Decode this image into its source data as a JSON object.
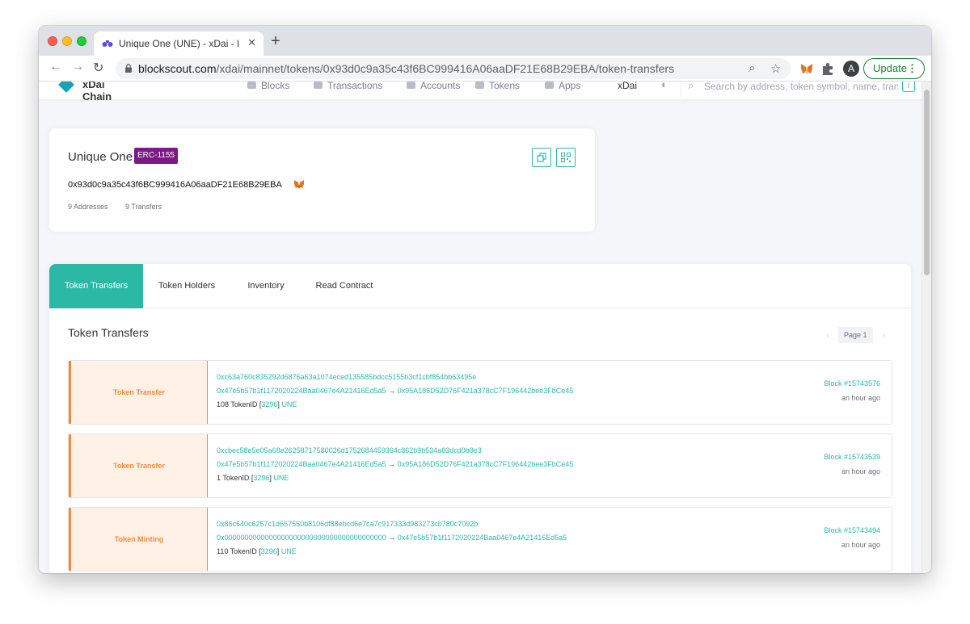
{
  "browser": {
    "tab_title": "Unique One (UNE) - xDai - Blo",
    "tab_close": "✕",
    "new_tab": "+",
    "url_host": "blockscout.com",
    "url_path": "/xdai/mainnet/tokens/0x93d0c9a35c43f6BC999416A06aaDF21E68B29EBA/token-transfers",
    "avatar_letter": "A",
    "update_label": "Update",
    "update_menu": "⋮"
  },
  "site_nav": {
    "logo_text": "xDai Chain",
    "items": [
      "Blocks",
      "Transactions",
      "Accounts",
      "Tokens",
      "Apps",
      "xDai"
    ],
    "search_placeholder": "Search by address, token symbol, name, transaction hash, or block number",
    "search_key": "/"
  },
  "token": {
    "name": "Unique One",
    "standard": "ERC-1155",
    "address": "0x93d0c9a35c43f6BC999416A06aaDF21E68B29EBA",
    "addresses_count": "9 Addresses",
    "transfers_count": "9 Transfers"
  },
  "tabs": [
    {
      "label": "Token Transfers",
      "active": true
    },
    {
      "label": "Token Holders",
      "active": false
    },
    {
      "label": "Inventory",
      "active": false
    },
    {
      "label": "Read Contract",
      "active": false
    }
  ],
  "transfers_section": {
    "title": "Token Transfers",
    "pager_prev": "‹",
    "page": "Page 1",
    "pager_next": "›"
  },
  "transfers": [
    {
      "type": "Token Transfer",
      "tx_hash": "0xc63a760c835292d6876a63a1074eced135585bdcc5155b3cf1cbf854bb63495e",
      "from": "0x47e5b57b1f1172020224Baa0467e4A21416Ed5a5",
      "arrow": "→",
      "to": "0x95A186D52D76F421a378cC7F196442bee3FbCe45",
      "amount": "108 TokenID [",
      "token_id": "3296",
      "amount_close": "]",
      "symbol": "UNE",
      "block": "Block #15743576",
      "time": "an hour ago"
    },
    {
      "type": "Token Transfer",
      "tx_hash": "0xcbec58e5e05a68e26258717580026d1752684459364c862b9b534a83dcd0b8e3",
      "from": "0x47e5b57b1f1172020224Baa0467e4A21416Ed5a5",
      "arrow": "→",
      "to": "0x95A186D52D76F421a378cC7F196442bee3FbCe45",
      "amount": "1 TokenID [",
      "token_id": "3296",
      "amount_close": "]",
      "symbol": "UNE",
      "block": "Block #15743539",
      "time": "an hour ago"
    },
    {
      "type": "Token Minting",
      "tx_hash": "0x86c640c6257c1d657550b8106df88ebcd6e7ca7c917333d983273cb780c7092b",
      "from": "0x0000000000000000000000000000000000000000",
      "arrow": "→",
      "to": "0x47e5b57b1f1172020224Baa0467e4A21416Ed5a5",
      "amount": "110 TokenID [",
      "token_id": "3296",
      "amount_close": "]",
      "symbol": "UNE",
      "block": "Block #15743494",
      "time": "an hour ago"
    }
  ],
  "colors": {
    "accent": "#2bb9a5",
    "badge": "#7b1a84",
    "tile_type": "#f3893d"
  }
}
